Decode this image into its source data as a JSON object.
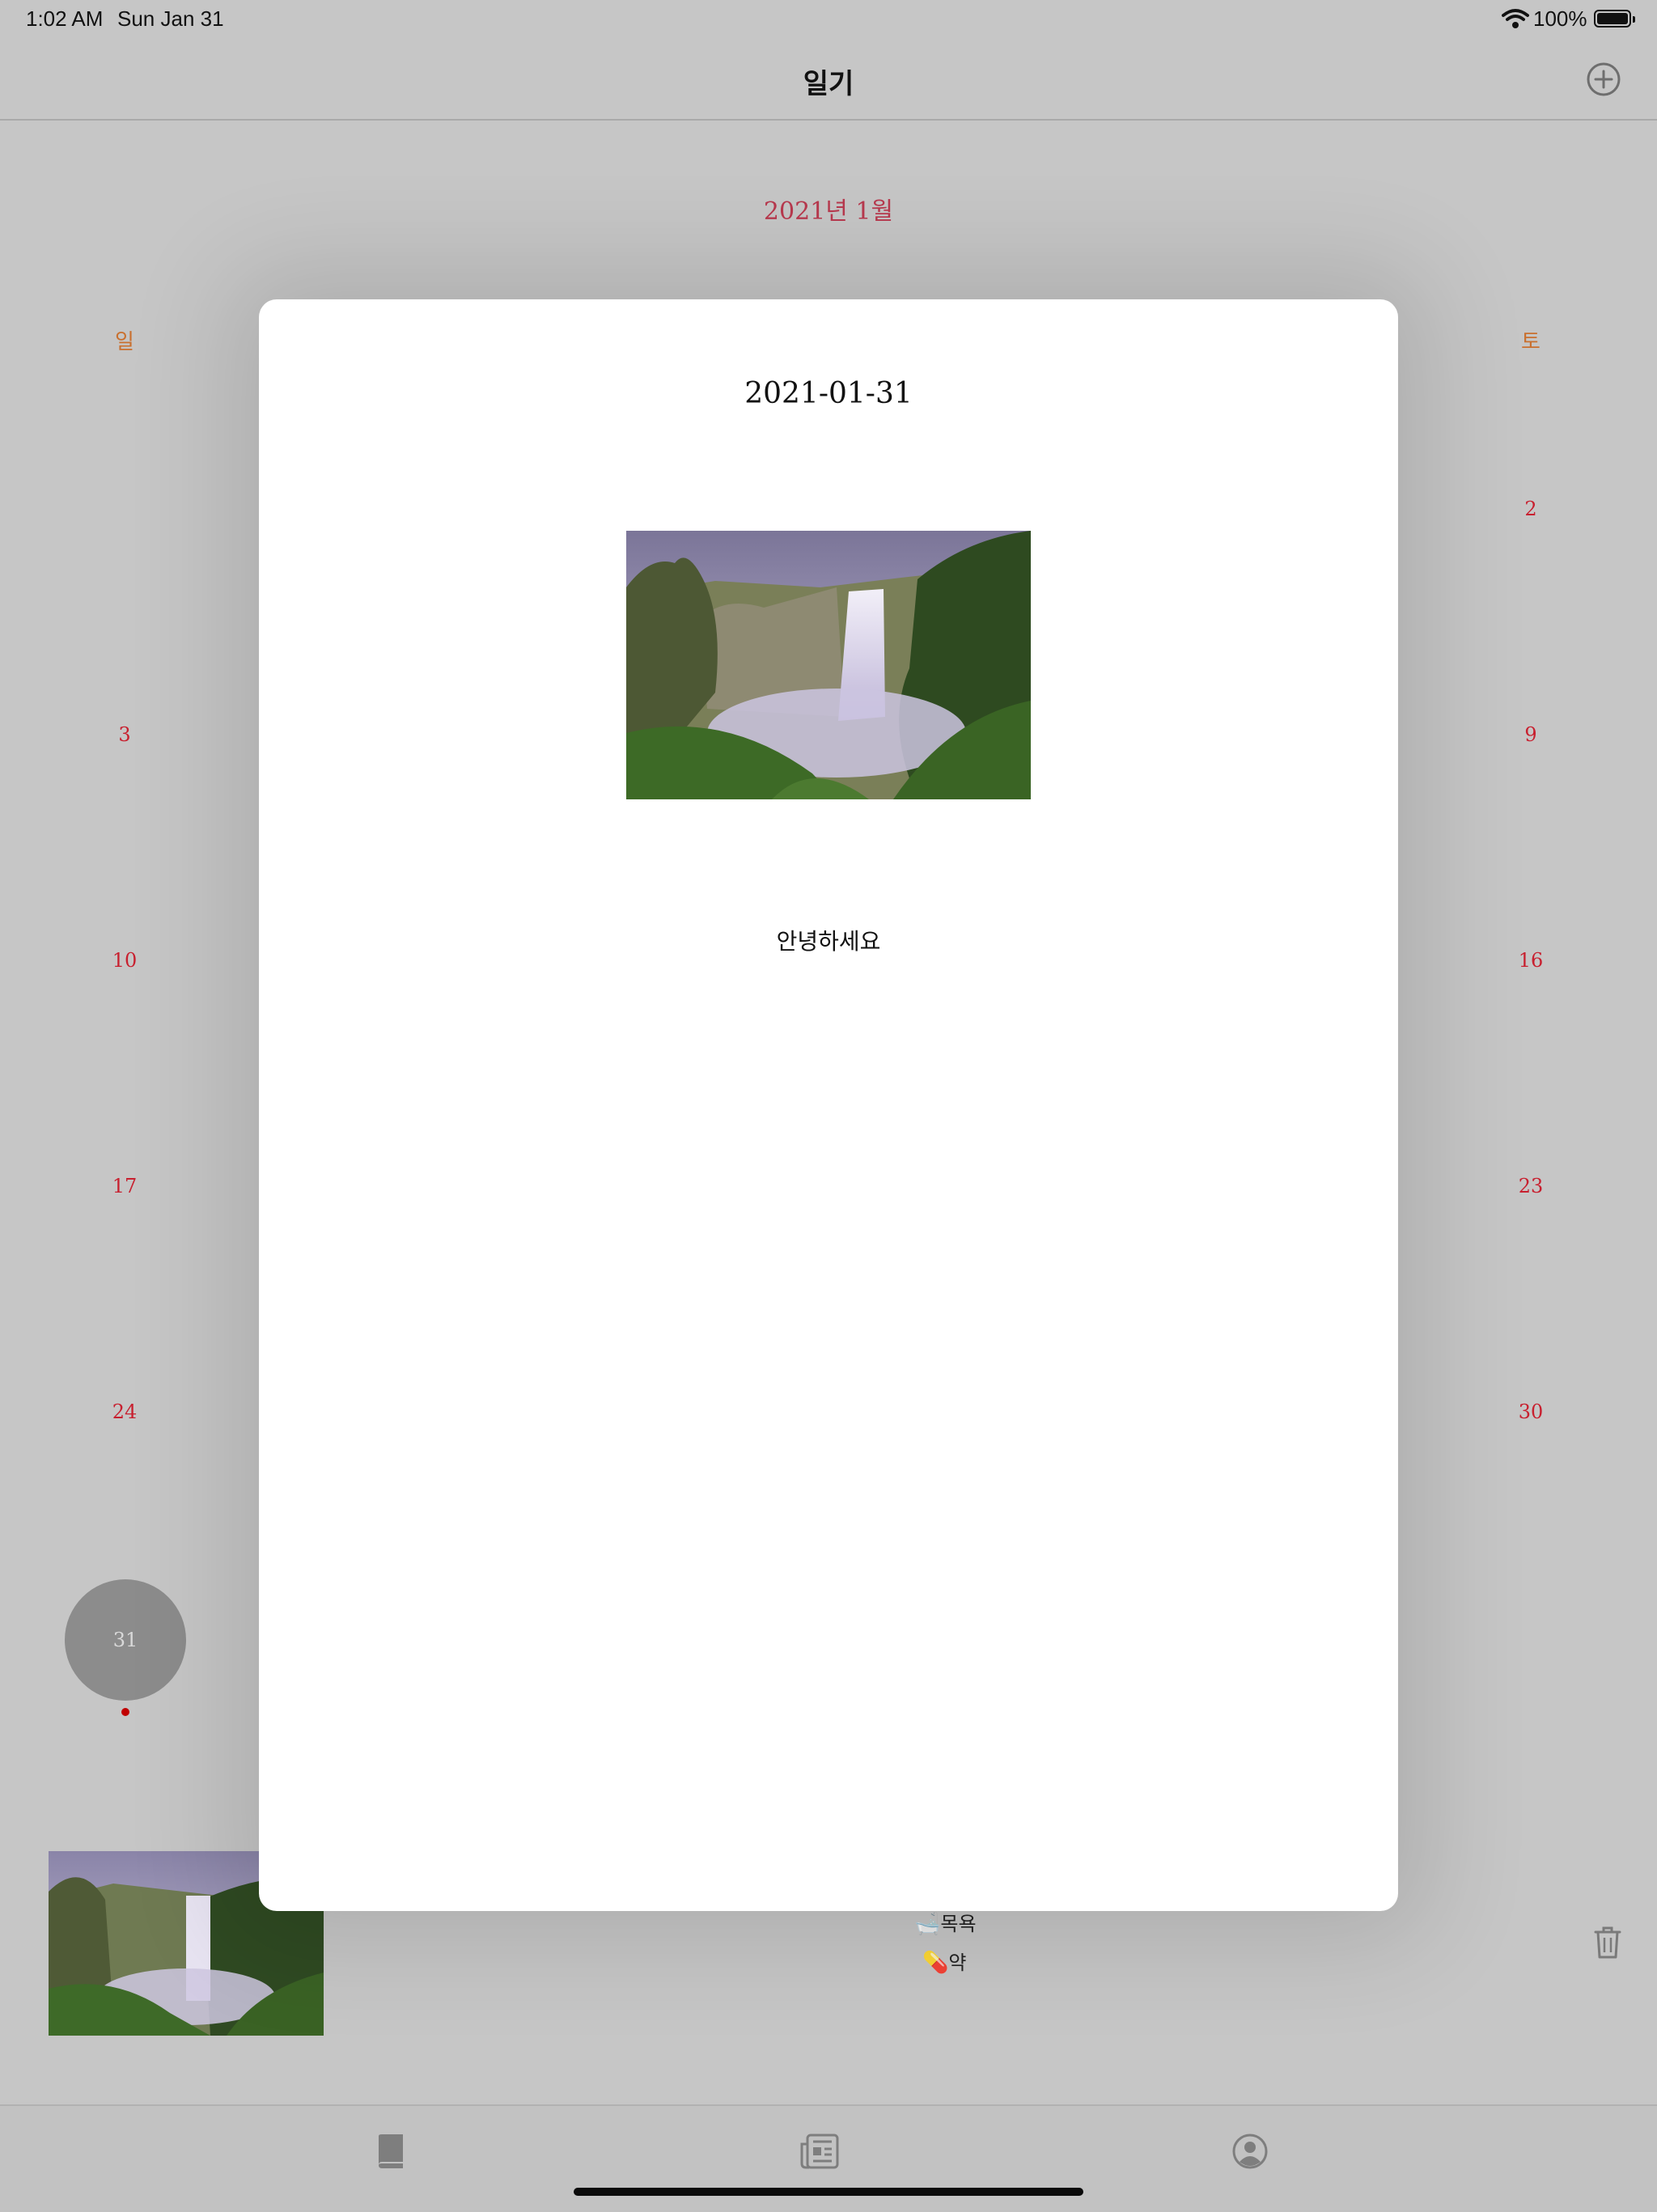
{
  "status_bar": {
    "time": "1:02 AM",
    "date": "Sun Jan 31",
    "battery": "100%",
    "battery_level": 1.0
  },
  "nav": {
    "title": "일기",
    "add_icon": "plus-circle-icon"
  },
  "calendar": {
    "month_title": "2021년 1월",
    "weekday_sun": "일",
    "weekday_sat": "토",
    "sunday_days": [
      "3",
      "10",
      "17",
      "24"
    ],
    "saturday_days": [
      "2",
      "9",
      "16",
      "23",
      "30"
    ],
    "selected_day": "31"
  },
  "entry": {
    "items": [
      {
        "icon": "🛁",
        "label": "목욕"
      },
      {
        "icon": "💊",
        "label": "약"
      }
    ],
    "delete_icon": "trash-icon"
  },
  "modal": {
    "date": "2021-01-31",
    "text": "안녕하세요"
  },
  "tab_bar": {
    "tabs": [
      "book-icon",
      "newspaper-icon",
      "person-circle-icon"
    ]
  },
  "colors": {
    "accent_red": "#c8202f",
    "weekday_orange": "#c9702f",
    "month_title": "#b8394e"
  }
}
